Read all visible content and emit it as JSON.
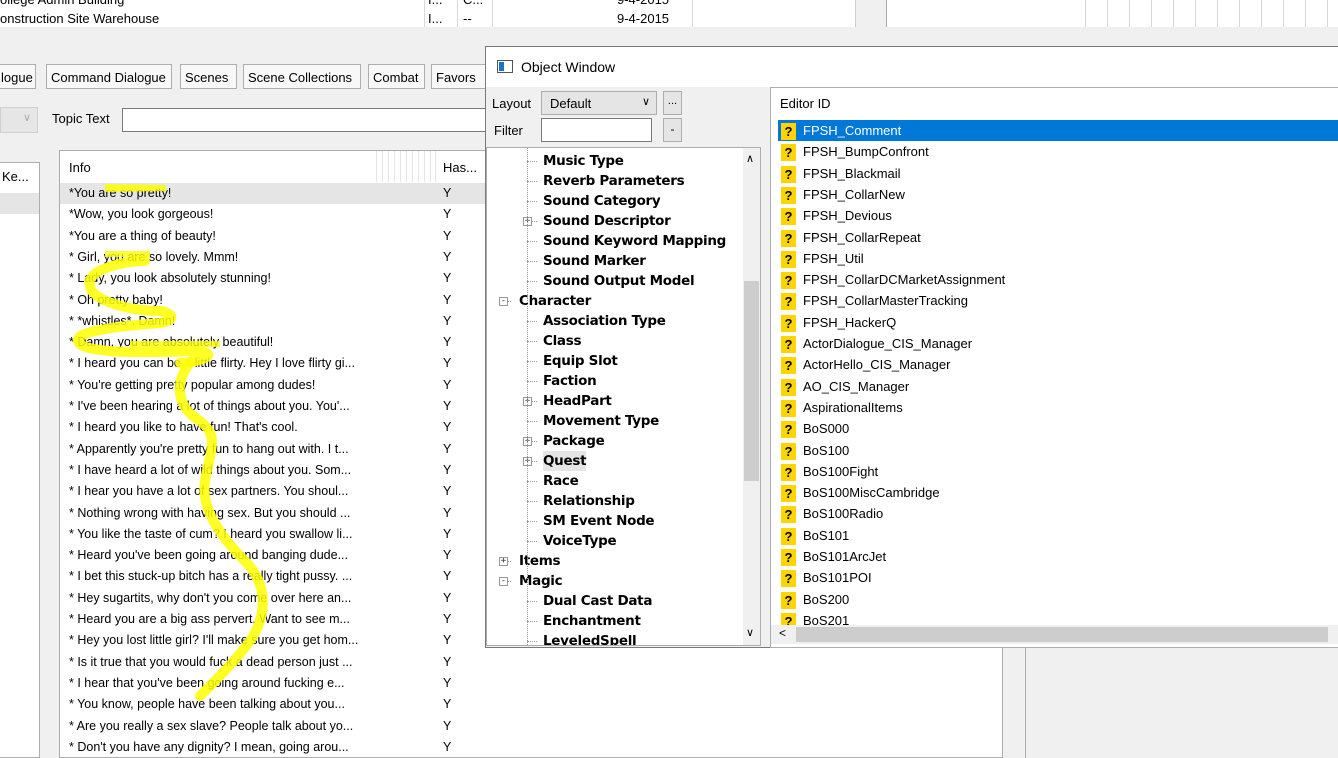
{
  "top_list": {
    "rows": [
      {
        "name": "ollege Admin Building",
        "a": "I...",
        "b": "C...",
        "date": "9-4-2015"
      },
      {
        "name": "onstruction Site Warehouse",
        "a": "I...",
        "b": "--",
        "date": "9-4-2015"
      }
    ]
  },
  "tabs": [
    "logue",
    "Command Dialogue",
    "Scenes",
    "Scene Collections",
    "Combat",
    "Favors"
  ],
  "topic_label": "Topic Text",
  "left_column_header": "Ke...",
  "info_table": {
    "headers": [
      "Info",
      "Has..."
    ],
    "rows": [
      [
        "*You are so pretty!",
        "Y"
      ],
      [
        "*Wow, you look gorgeous!",
        "Y"
      ],
      [
        "*You are a thing of beauty!",
        "Y"
      ],
      [
        "* Girl, you are so lovely. Mmm!",
        "Y"
      ],
      [
        "* Lady, you look absolutely stunning!",
        "Y"
      ],
      [
        "* Oh pretty baby!",
        "Y"
      ],
      [
        "* *whistles*. Damn!",
        "Y"
      ],
      [
        "* Damn, you are absolutely beautiful!",
        "Y"
      ],
      [
        "* I heard you can be a little flirty. Hey I love flirty gi...",
        "Y"
      ],
      [
        "* You're getting pretty popular among dudes!",
        "Y"
      ],
      [
        "* I've been hearing a lot of things about you. You'...",
        "Y"
      ],
      [
        "* I heard you like to have fun! That's cool.",
        "Y"
      ],
      [
        "* Apparently you're pretty fun to hang out with. I t...",
        "Y"
      ],
      [
        "* I have heard a lot of wild things about you. Som...",
        "Y"
      ],
      [
        "* I hear you have a lot of sex partners. You shoul...",
        "Y"
      ],
      [
        "* Nothing wrong with having sex. But you should ...",
        "Y"
      ],
      [
        "* You like the taste of cum? I heard you swallow li...",
        "Y"
      ],
      [
        "* Heard you've been going around banging dude...",
        "Y"
      ],
      [
        "* I bet this stuck-up bitch has a really tight pussy. ...",
        "Y"
      ],
      [
        "* Hey sugartits, why don't you come over here an...",
        "Y"
      ],
      [
        "* Heard you are a big ass pervert. Want to see m...",
        "Y"
      ],
      [
        "* Hey you lost little girl? I'll make sure you get hom...",
        "Y"
      ],
      [
        "* Is it true that you would fuck a dead person just ...",
        "Y"
      ],
      [
        "* I hear that you've been going around fucking e...",
        "Y"
      ],
      [
        "* You know, people have been talking about you...",
        "Y"
      ],
      [
        "* Are you really a sex slave? People talk about yo...",
        "Y"
      ],
      [
        "* Don't you have any dignity? I mean, going arou...",
        "Y"
      ]
    ]
  },
  "object_window": {
    "title": "Object Window",
    "layout_label": "Layout",
    "layout_value": "Default",
    "browse_label": "...",
    "filter_label": "Filter",
    "filter_value": "",
    "filter_btn": "-",
    "tree": [
      {
        "label": "Music Type",
        "level": 1
      },
      {
        "label": "Reverb Parameters",
        "level": 1
      },
      {
        "label": "Sound Category",
        "level": 1
      },
      {
        "label": "Sound Descriptor",
        "level": 1,
        "expander": "+"
      },
      {
        "label": "Sound Keyword Mapping",
        "level": 1
      },
      {
        "label": "Sound Marker",
        "level": 1
      },
      {
        "label": "Sound Output Model",
        "level": 1
      },
      {
        "label": "Character",
        "level": 0,
        "expander": "-"
      },
      {
        "label": "Association Type",
        "level": 1
      },
      {
        "label": "Class",
        "level": 1
      },
      {
        "label": "Equip Slot",
        "level": 1
      },
      {
        "label": "Faction",
        "level": 1
      },
      {
        "label": "HeadPart",
        "level": 1,
        "expander": "+"
      },
      {
        "label": "Movement Type",
        "level": 1
      },
      {
        "label": "Package",
        "level": 1,
        "expander": "+"
      },
      {
        "label": "Quest",
        "level": 1,
        "expander": "+"
      },
      {
        "label": "Race",
        "level": 1
      },
      {
        "label": "Relationship",
        "level": 1
      },
      {
        "label": "SM Event Node",
        "level": 1
      },
      {
        "label": "VoiceType",
        "level": 1
      },
      {
        "label": "Items",
        "level": 0,
        "expander": "+"
      },
      {
        "label": "Magic",
        "level": 0,
        "expander": "-"
      },
      {
        "label": "Dual Cast Data",
        "level": 1
      },
      {
        "label": "Enchantment",
        "level": 1
      },
      {
        "label": "LeveledSpell",
        "level": 1
      }
    ],
    "editor_header": "Editor ID",
    "editor_ids": [
      "FPSH_Comment",
      "FPSH_BumpConfront",
      "FPSH_Blackmail",
      "FPSH_CollarNew",
      "FPSH_Devious",
      "FPSH_CollarRepeat",
      "FPSH_Util",
      "FPSH_CollarDCMarketAssignment",
      "FPSH_CollarMasterTracking",
      "FPSH_HackerQ",
      "ActorDialogue_CIS_Manager",
      "ActorHello_CIS_Manager",
      "AO_CIS_Manager",
      "AspirationalItems",
      "BoS000",
      "BoS100",
      "BoS100Fight",
      "BoS100MiscCambridge",
      "BoS100Radio",
      "BoS101",
      "BoS101ArcJet",
      "BoS101POI",
      "BoS200",
      "BoS201"
    ],
    "selected_index": 0,
    "question_glyph": "?"
  },
  "colors": {
    "selection": "#0078d7",
    "highlight": "#ffff00",
    "question_badge": "#ffd400"
  }
}
